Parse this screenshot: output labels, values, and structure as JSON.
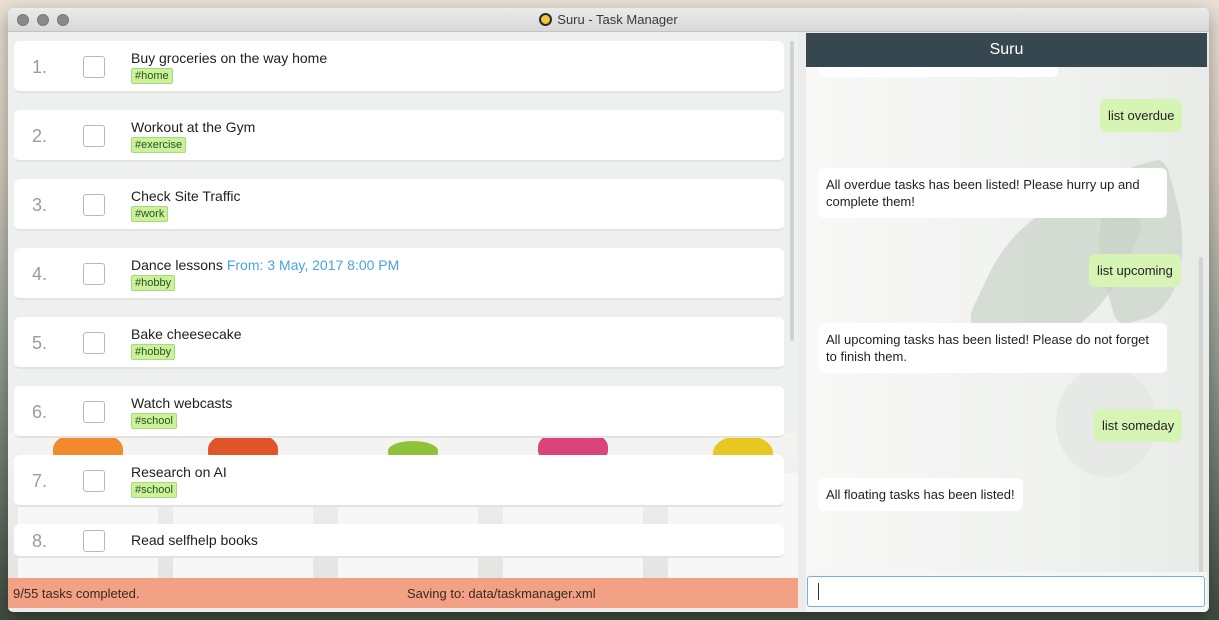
{
  "window": {
    "title": "Suru - Task Manager"
  },
  "tasks": [
    {
      "index": "1.",
      "name": "Buy groceries on the way home",
      "date": "",
      "tag": "#home"
    },
    {
      "index": "2.",
      "name": "Workout at the Gym",
      "date": "",
      "tag": "#exercise"
    },
    {
      "index": "3.",
      "name": "Check Site Traffic",
      "date": "",
      "tag": "#work"
    },
    {
      "index": "4.",
      "name": "Dance lessons",
      "date": "From: 3 May, 2017 8:00 PM",
      "tag": "#hobby"
    },
    {
      "index": "5.",
      "name": "Bake cheesecake",
      "date": "",
      "tag": "#hobby"
    },
    {
      "index": "6.",
      "name": "Watch webcasts",
      "date": "",
      "tag": "#school"
    },
    {
      "index": "7.",
      "name": "Research on AI",
      "date": "",
      "tag": "#school"
    },
    {
      "index": "8.",
      "name": "Read selfhelp books",
      "date": "",
      "tag": ""
    }
  ],
  "status": {
    "completed": "9/55 tasks completed.",
    "saving": "Saving to: data/taskmanager.xml"
  },
  "chat": {
    "header": "Suru",
    "messages": [
      {
        "from": "user",
        "text": "list overdue"
      },
      {
        "from": "bot",
        "text": "All overdue tasks has been listed! Please hurry up and complete them!"
      },
      {
        "from": "user",
        "text": "list upcoming"
      },
      {
        "from": "bot",
        "text": "All upcoming tasks has been listed! Please do not forget to finish them."
      },
      {
        "from": "user",
        "text": "list someday"
      },
      {
        "from": "bot",
        "text": "All floating tasks has been listed!"
      }
    ],
    "input_value": ""
  },
  "colors": {
    "header_bg": "#37474f",
    "status_bg": "#f2a185",
    "user_bubble": "#d6f5b4",
    "tag_bg": "#c9f29b",
    "date_text": "#4aa3df"
  }
}
